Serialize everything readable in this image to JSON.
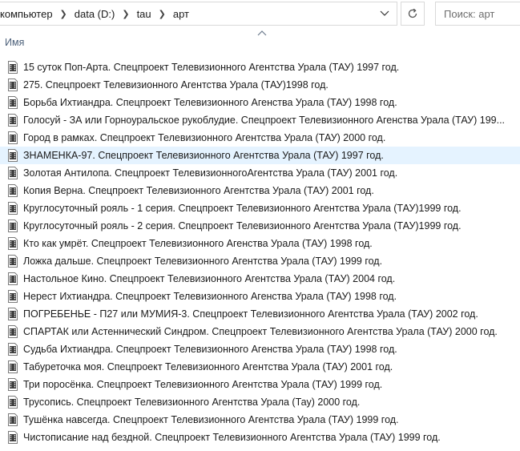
{
  "breadcrumb": {
    "items": [
      "компьютер",
      "data (D:)",
      "tau",
      "арт"
    ]
  },
  "search": {
    "placeholder": "Поиск: арт"
  },
  "columns": {
    "name": "Имя"
  },
  "colors": {
    "selection": "#e5f3ff",
    "header_text": "#4c607a"
  },
  "files": [
    {
      "name": "15 суток Поп-Арта. Спецпроект Телевизионного Агентства Урала (ТАУ) 1997 год."
    },
    {
      "name": "275. Спецпроект Телевизионного Агентства Урала (ТАУ)1998 год."
    },
    {
      "name": "Борьба Ихтиандра.  Спецпроект Телевизионного Агенства Урала (ТАУ) 1998 год."
    },
    {
      "name": "Голосуй - ЗА или Горноуральское рукоблудие. Спецпроект Телевизионного Агенства Урала (ТАУ) 199..."
    },
    {
      "name": "Город в рамках. Спецпроект Телевизионного Агентства Урала (ТАУ) 2000 год."
    },
    {
      "name": "ЗНАМЕНКА-97. Спецпроект Телевизионного Агентства Урала (ТАУ) 1997 год.",
      "selected": true
    },
    {
      "name": "Золотая Антилопа. Спецпроект ТелевизионногоАгентства Урала (ТАУ) 2001 год."
    },
    {
      "name": "Копия Верна. Спецпроект Телевизионного Агентства Урала (ТАУ) 2001 год."
    },
    {
      "name": "Круглосуточный рояль - 1 серия.  Спецпроект Телевизионного Агентства Урала (ТАУ)1999 год."
    },
    {
      "name": "Круглосуточный рояль - 2 серия. Спецпроект Телевизионного Агентства Урала (ТАУ)1999 год."
    },
    {
      "name": "Кто как умрёт. Спецпроект Телевизионного Агенства Урала (ТАУ) 1998 год."
    },
    {
      "name": "Ложка дальше. Спецпроект Телевизионного Агентства Урала (ТАУ) 1999 год."
    },
    {
      "name": "Настольное Кино. Спецпроект Телевизионного Агентства Урала (ТАУ) 2004 год."
    },
    {
      "name": "Нерест Ихтиандра. Спецпроект Телевизионного Агенства Урала (ТАУ) 1998 год."
    },
    {
      "name": "ПОГРЕБЕНЬЕ - П27 или МУМИЯ-3. Спецпроект Телевизионного Агентства Урала (ТАУ) 2002 год."
    },
    {
      "name": "СПАРТАК или Астеннический Синдром. Спецпроект Телевизионного Агентства Урала (ТАУ) 2000 год."
    },
    {
      "name": "Судьба Ихтиандра. Спецпроект Телевизионного Агенства Урала (ТАУ) 1998 год."
    },
    {
      "name": "Табуреточка моя.  Спецпроект Телевизионного Агентства Урала (ТАУ) 2001 год."
    },
    {
      "name": "Три поросёнка. Спецпроект Телевизионного Агентства Урала (ТАУ) 1999 год."
    },
    {
      "name": "Трусопись. Спецпроект Телевизионного Агентства Урала (Тау) 2000 год."
    },
    {
      "name": "Тушёнка навсегда. Спецпроект Телевизионного Агентства Урала (ТАУ) 1999 год."
    },
    {
      "name": "Чистописание над бездной. Спецпроект Телевизионного Агентства Урала (ТАУ) 1999 год."
    }
  ]
}
